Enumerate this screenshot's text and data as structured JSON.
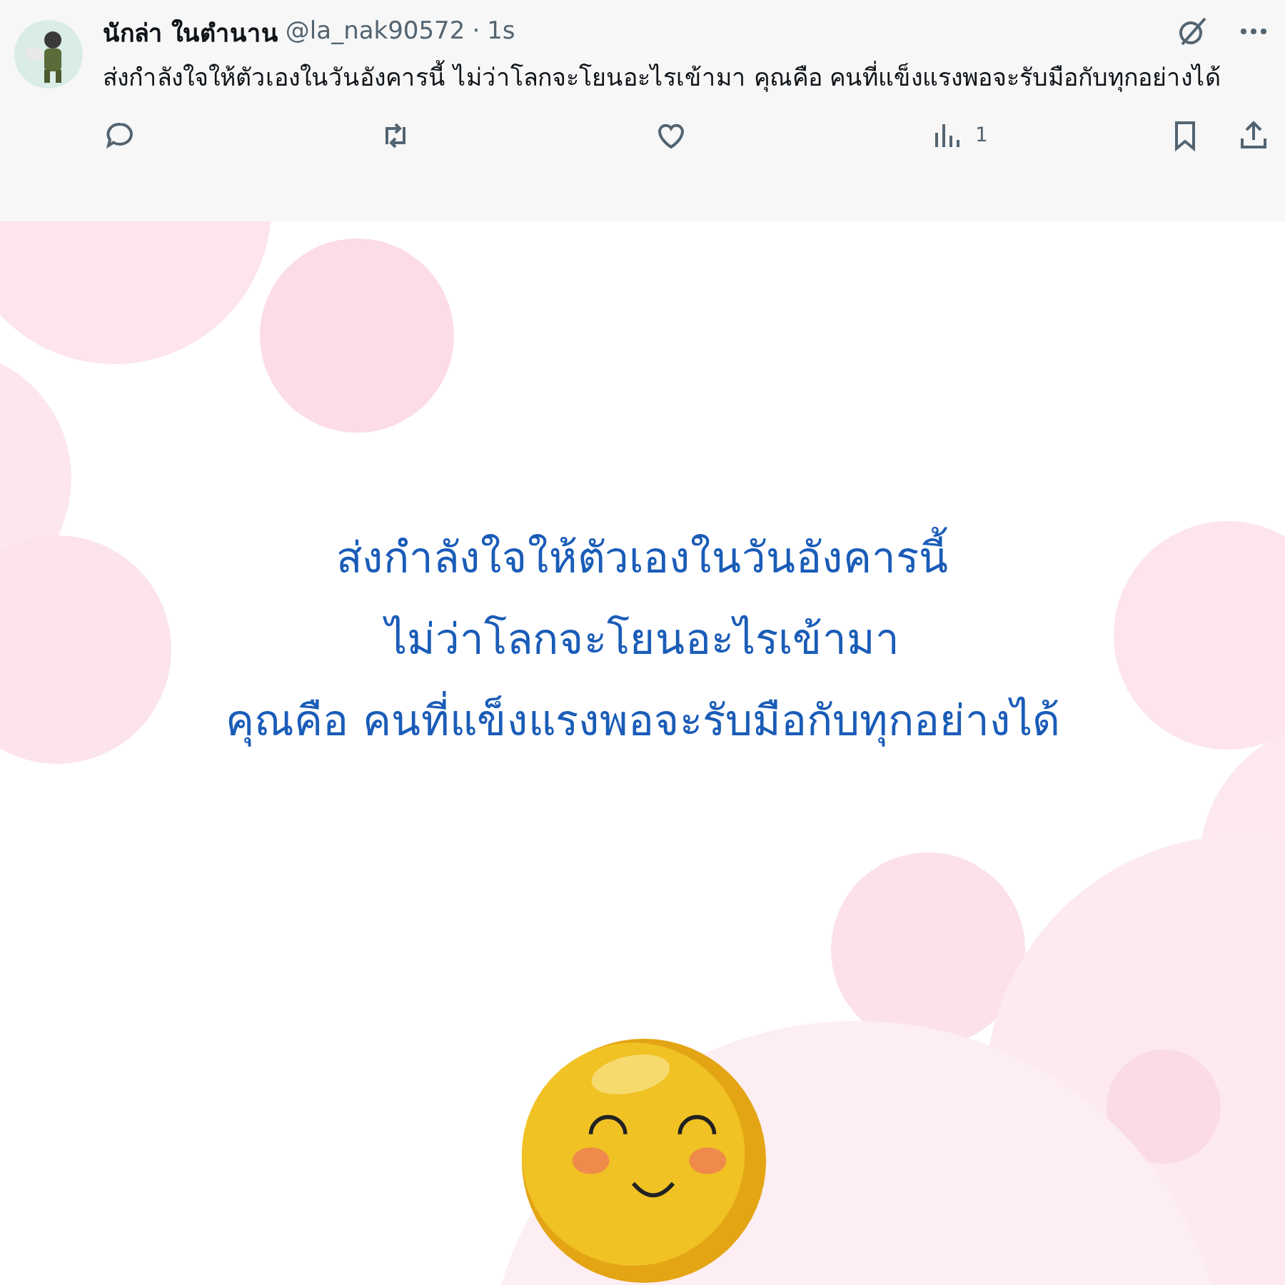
{
  "post": {
    "author": "นักล่า ในตำนาน",
    "handle": "@la_nak90572",
    "separator": "·",
    "time": "1s",
    "text": "ส่งกำลังใจให้ตัวเองในวันอังคารนี้ ไม่ว่าโลกจะโยนอะไรเข้ามา คุณคือ คนที่แข็งแรงพอจะรับมือกับทุกอย่างได้",
    "actions": [
      {
        "kind": "reply"
      },
      {
        "kind": "repost"
      },
      {
        "kind": "like"
      },
      {
        "kind": "views",
        "count": "1"
      },
      {
        "kind": "bookmark"
      },
      {
        "kind": "share"
      }
    ]
  },
  "image": {
    "lines": [
      "ส่งกำลังใจให้ตัวเองในวันอังคารนี้",
      "ไม่ว่าโลกจะโยนอะไรเข้ามา",
      "คุณคือ คนที่แข็งแรงพอจะรับมือกับทุกอย่างได้"
    ]
  }
}
